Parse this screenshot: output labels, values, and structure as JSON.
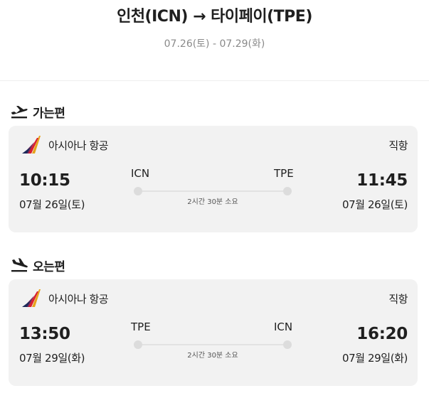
{
  "header": {
    "route": "인천(ICN) → 타이페이(TPE)",
    "dates": "07.26(토) - 07.29(화)"
  },
  "colors": {
    "card_bg": "#f2f2f2",
    "text_primary": "#1f1f1f",
    "text_secondary": "#8a8a8a",
    "timeline_dot": "#dcdcdc",
    "logo_red": "#d8202f",
    "logo_gold": "#e7a21b",
    "logo_navy": "#1d2a5a"
  },
  "outbound": {
    "section_label": "가는편",
    "section_icon": "plane-departure-icon",
    "airline": "아시아나 항공",
    "airline_icon": "asiana-airlines-logo",
    "stop_type": "직항",
    "departure": {
      "code": "ICN",
      "time": "10:15",
      "date": "07월 26일(토)"
    },
    "arrival": {
      "code": "TPE",
      "time": "11:45",
      "date": "07월 26일(토)"
    },
    "duration": "2시간 30분 소요"
  },
  "inbound": {
    "section_label": "오는편",
    "section_icon": "plane-arrival-icon",
    "airline": "아시아나 항공",
    "airline_icon": "asiana-airlines-logo",
    "stop_type": "직항",
    "departure": {
      "code": "TPE",
      "time": "13:50",
      "date": "07월 29일(화)"
    },
    "arrival": {
      "code": "ICN",
      "time": "16:20",
      "date": "07월 29일(화)"
    },
    "duration": "2시간 30분 소요"
  }
}
